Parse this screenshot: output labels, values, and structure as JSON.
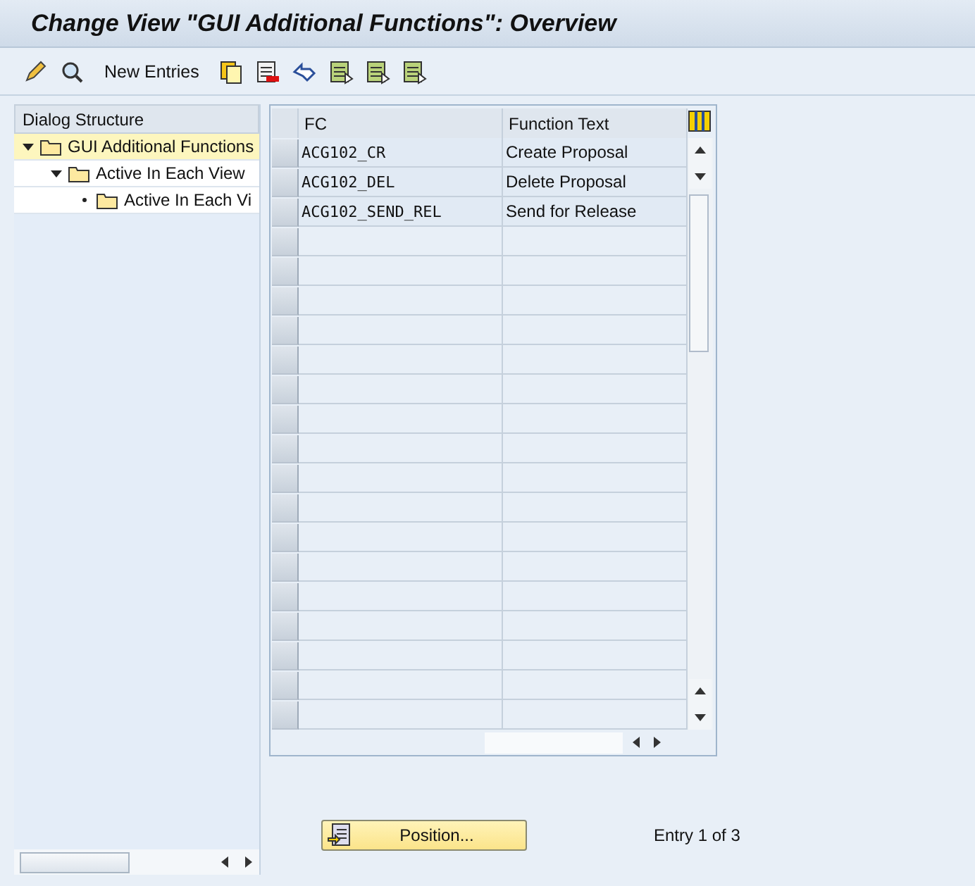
{
  "window": {
    "title": "Change View \"GUI Additional Functions\": Overview"
  },
  "toolbar": {
    "new_entries": "New Entries"
  },
  "dialog_structure": {
    "heading": "Dialog Structure",
    "items": [
      {
        "label": "GUI Additional Functions",
        "selected": true,
        "expanded": true,
        "children": [
          {
            "label": "Active In Each View",
            "selected": false,
            "expanded": true,
            "children": [
              {
                "label": "Active In Each Vi",
                "selected": false
              }
            ]
          }
        ]
      }
    ]
  },
  "table": {
    "columns": [
      "FC",
      "Function Text"
    ],
    "rows": [
      [
        "ACG102_CR",
        "Create Proposal"
      ],
      [
        "ACG102_DEL",
        "Delete Proposal"
      ],
      [
        "ACG102_SEND_REL",
        "Send for Release"
      ]
    ]
  },
  "footer": {
    "position_button": "Position...",
    "entry_count": "Entry 1 of 3"
  }
}
